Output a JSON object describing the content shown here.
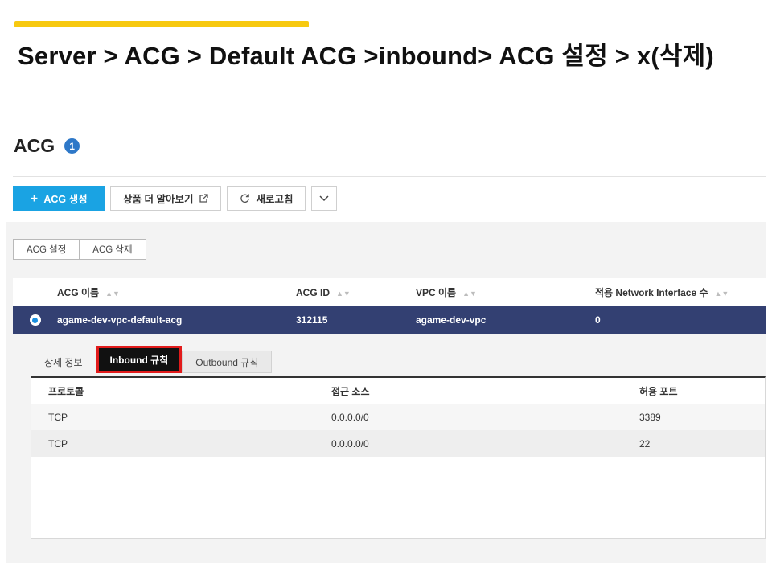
{
  "slide": {
    "title": "Server > ACG > Default ACG >inbound> ACG 설정 > x(삭제)",
    "accent_color": "#f7c910"
  },
  "page": {
    "heading": "ACG",
    "badge": "1"
  },
  "toolbar": {
    "create_label": "ACG 생성",
    "learn_more_label": "상품 더 알아보기",
    "refresh_label": "새로고침",
    "primary_color": "#1aa3e3"
  },
  "actions": {
    "acg_settings": "ACG 설정",
    "acg_delete": "ACG 삭제"
  },
  "acg_table": {
    "headers": [
      "ACG 이름",
      "ACG ID",
      "VPC 이름",
      "적용 Network Interface 수"
    ],
    "rows": [
      {
        "name": "agame-dev-vpc-default-acg",
        "id": "312115",
        "vpc": "agame-dev-vpc",
        "nic_count": "0",
        "selected": true
      }
    ],
    "selected_color": "#334072"
  },
  "detail_tabs": {
    "items": [
      "상세 정보",
      "Inbound 규칙",
      "Outbound 규칙"
    ],
    "active": "Inbound 규칙",
    "highlight_color": "#e21b1b"
  },
  "rules_table": {
    "headers": [
      "프로토콜",
      "접근 소스",
      "허용 포트"
    ],
    "rows": [
      [
        "TCP",
        "0.0.0.0/0",
        "3389"
      ],
      [
        "TCP",
        "0.0.0.0/0",
        "22"
      ]
    ]
  }
}
